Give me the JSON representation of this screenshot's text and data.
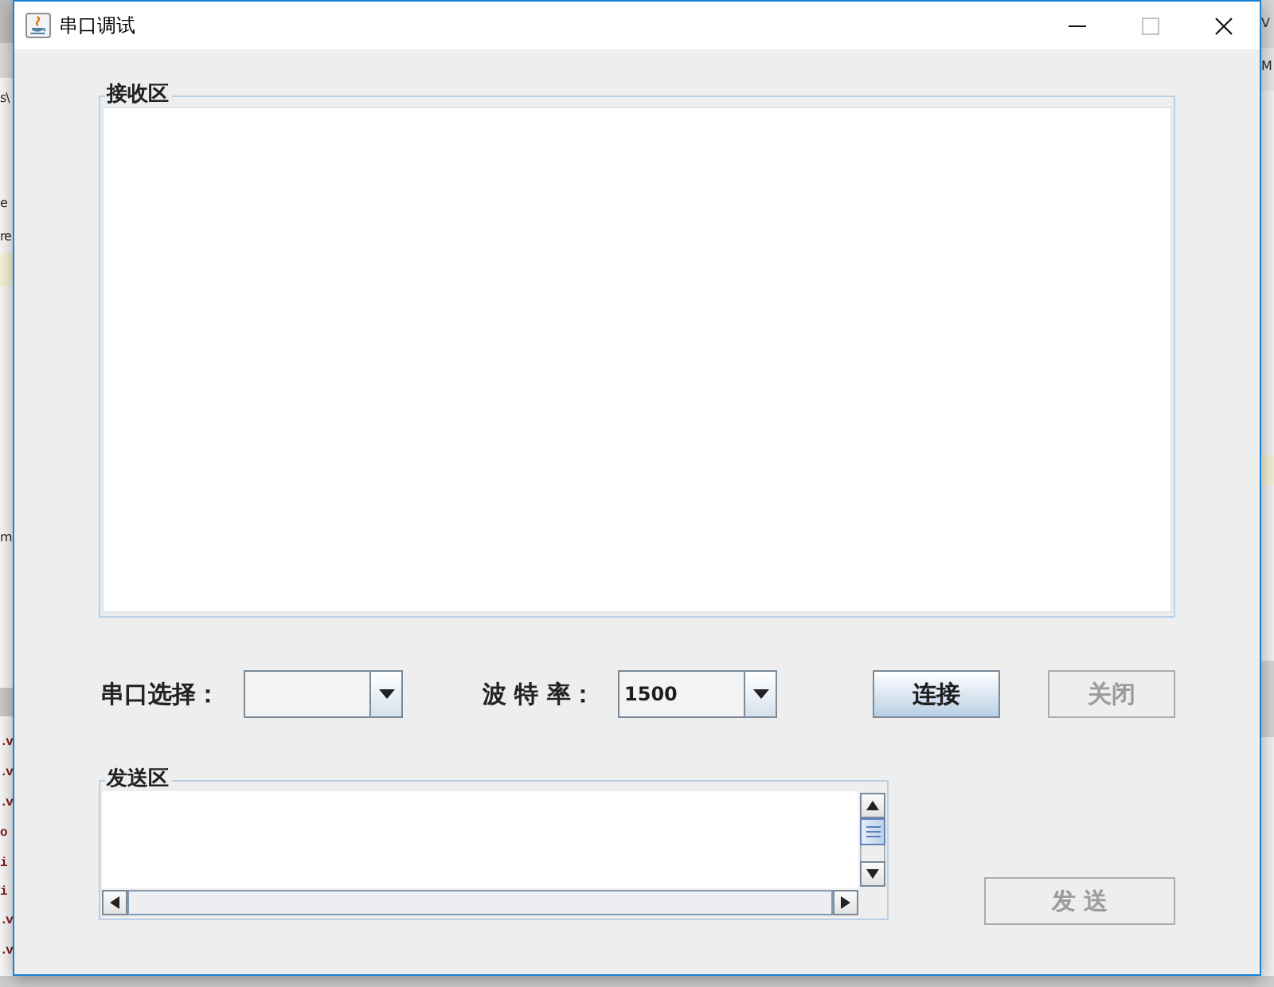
{
  "background": {
    "left_texts": [
      {
        "text": "s\\",
        "kind": "plain"
      },
      {
        "text": "e",
        "kind": "plain"
      },
      {
        "text": "re",
        "kind": "plain"
      },
      {
        "text": "m",
        "kind": "plain"
      },
      {
        "text": ".v",
        "kind": "code"
      },
      {
        "text": ".v",
        "kind": "code"
      },
      {
        "text": ".v",
        "kind": "code"
      },
      {
        "text": "o",
        "kind": "code"
      },
      {
        "text": "i",
        "kind": "code"
      },
      {
        "text": "i",
        "kind": "code"
      },
      {
        "text": ".v",
        "kind": "code"
      },
      {
        "text": ".v",
        "kind": "code"
      }
    ],
    "right_texts": [
      {
        "text": "V",
        "kind": "plain"
      },
      {
        "text": "M",
        "kind": "plain"
      }
    ]
  },
  "window": {
    "title": "串口调试"
  },
  "window_controls": [
    {
      "kind": "minimize",
      "disabled": false
    },
    {
      "kind": "maximize",
      "disabled": true
    },
    {
      "kind": "close",
      "disabled": false
    }
  ],
  "receive_area": {
    "title": "接收区"
  },
  "controls": [
    {
      "kind": "label",
      "text": "串口选择："
    },
    {
      "kind": "dropdown"
    },
    {
      "kind": "label",
      "text": "波 特 率："
    },
    {
      "kind": "dropdown",
      "value": "1500"
    },
    {
      "kind": "button",
      "label": "连接",
      "disabled": false
    },
    {
      "kind": "button",
      "label": "关闭",
      "disabled": true
    }
  ],
  "send_area": {
    "title": "发送区"
  },
  "send_button": {
    "label": "发 送",
    "disabled": true
  }
}
